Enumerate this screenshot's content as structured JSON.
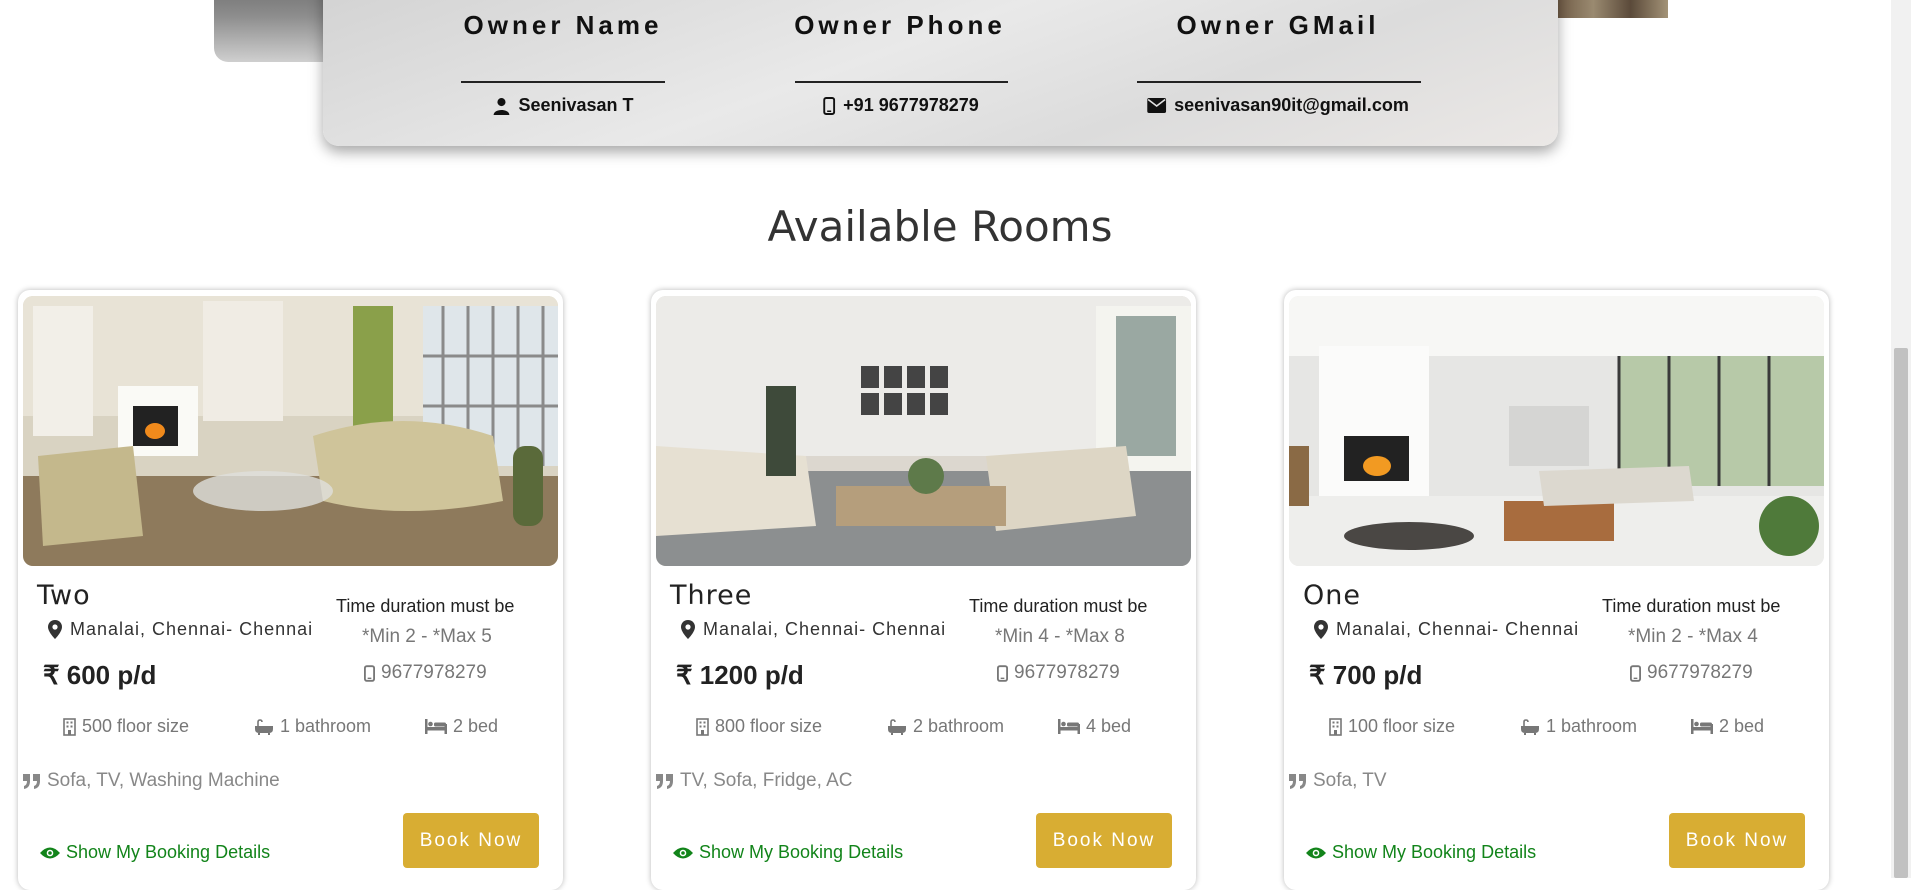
{
  "owner": {
    "name_heading": "Owner Name",
    "phone_heading": "Owner Phone",
    "gmail_heading": "Owner GMail",
    "name": "Seenivasan T",
    "phone": "+91 9677978279",
    "gmail": "seenivasan90it@gmail.com"
  },
  "section_title": "Available Rooms",
  "rooms": [
    {
      "name": "Two",
      "location": "Manalai, Chennai- Chennai",
      "price": "₹ 600 p/d",
      "duration_title": "Time duration must be",
      "duration": "*Min 2 - *Max 5",
      "phone": "9677978279",
      "floor": "500 floor size",
      "bathroom": "1 bathroom",
      "bed": "2 bed",
      "amenities": "Sofa, TV, Washing Machine",
      "show_label": "Show My Booking Details",
      "book_label": "Book Now"
    },
    {
      "name": "Three",
      "location": "Manalai, Chennai- Chennai",
      "price": "₹ 1200 p/d",
      "duration_title": "Time duration must be",
      "duration": "*Min 4 - *Max 8",
      "phone": "9677978279",
      "floor": "800 floor size",
      "bathroom": "2 bathroom",
      "bed": "4 bed",
      "amenities": "TV, Sofa, Fridge, AC",
      "show_label": "Show My Booking Details",
      "book_label": "Book Now"
    },
    {
      "name": "One",
      "location": "Manalai, Chennai- Chennai",
      "price": "₹ 700 p/d",
      "duration_title": "Time duration must be",
      "duration": "*Min 2 - *Max 4",
      "phone": "9677978279",
      "floor": "100 floor size",
      "bathroom": "1 bathroom",
      "bed": "2 bed",
      "amenities": "Sofa, TV",
      "show_label": "Show My Booking Details",
      "book_label": "Book Now"
    }
  ],
  "colors": {
    "accent_button": "#d8ad33",
    "link_green": "#12841a"
  },
  "icons": [
    "user-icon",
    "mobile-icon",
    "envelope-icon",
    "map-marker-icon",
    "building-icon",
    "bath-icon",
    "bed-icon",
    "quote-icon",
    "eye-icon"
  ]
}
